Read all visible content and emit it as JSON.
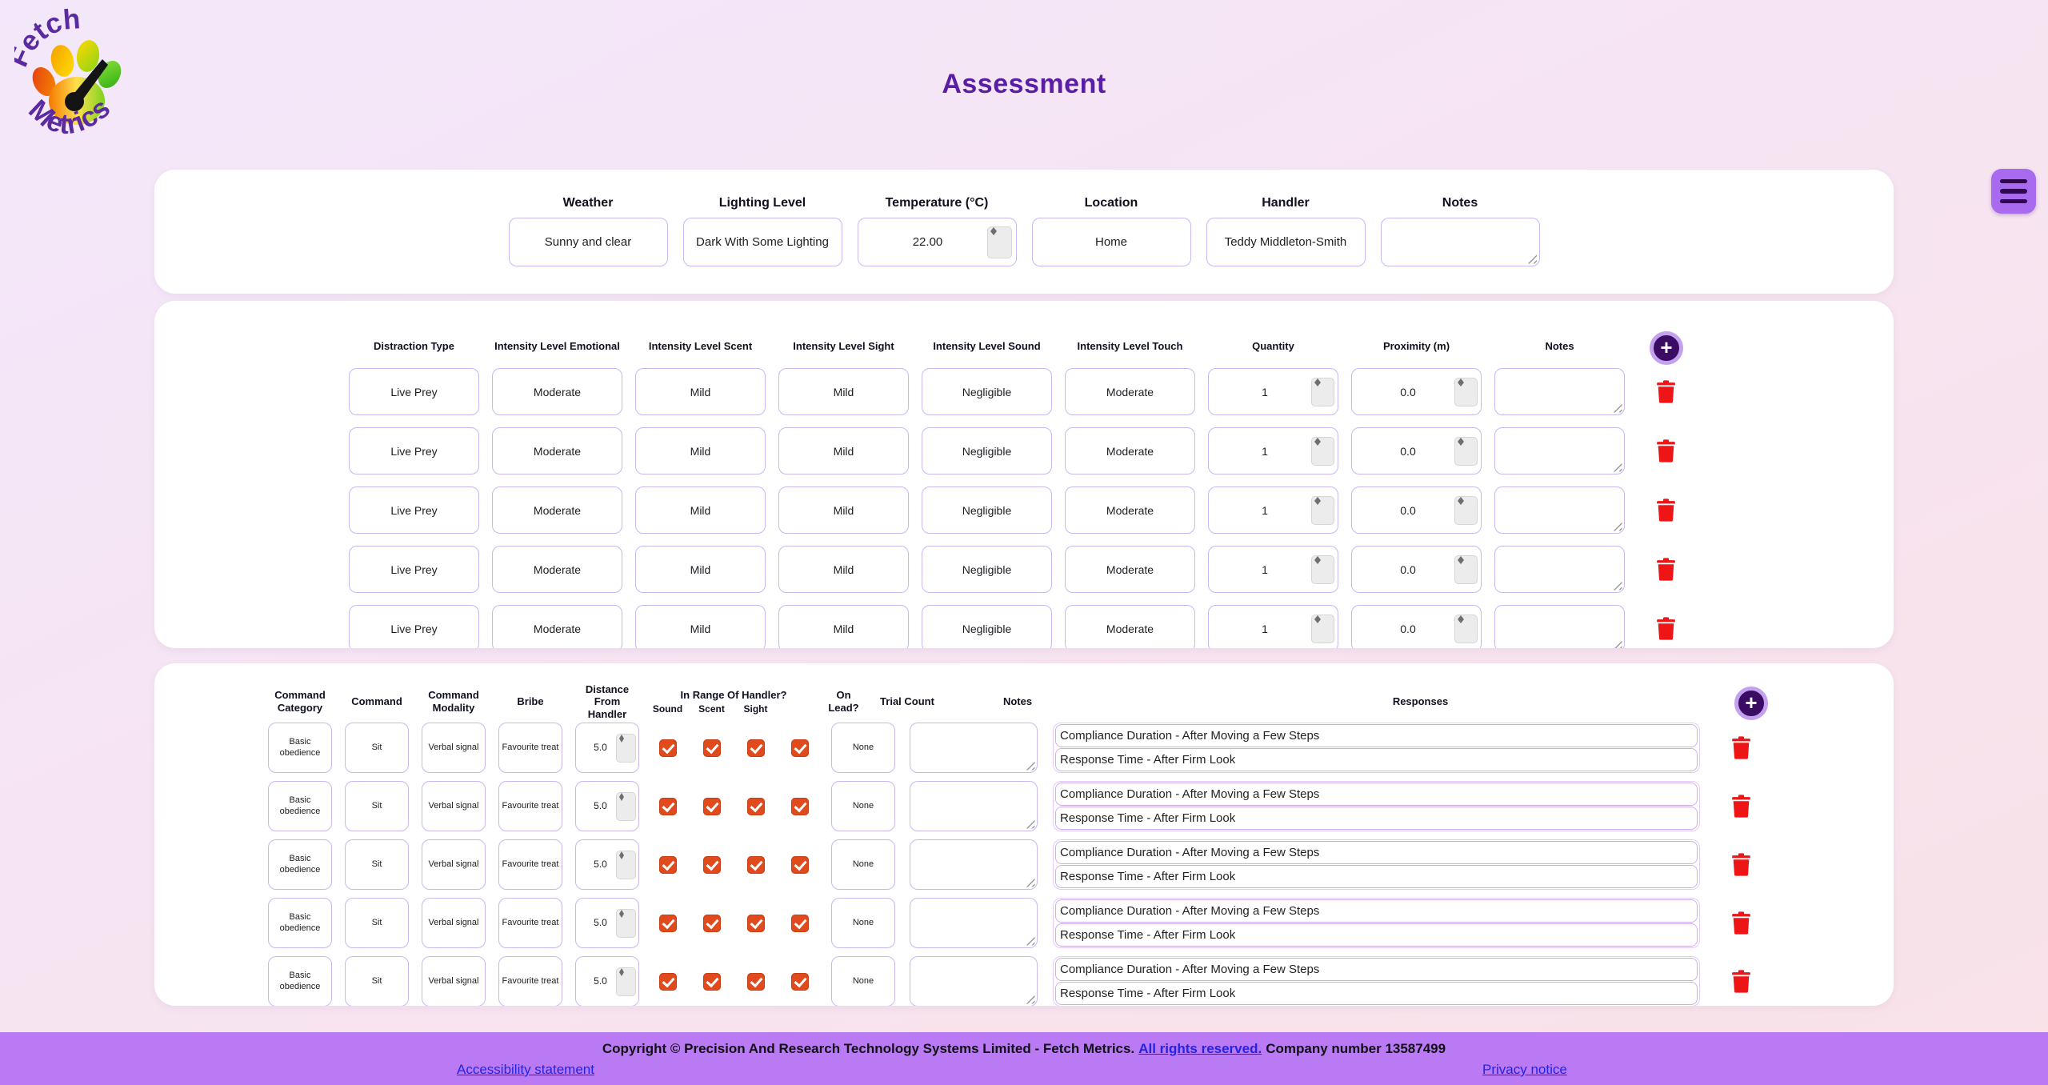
{
  "page_title": "Assessment",
  "logo": {
    "line1": "Fetch",
    "line2": "Metrics"
  },
  "environment": {
    "fields": [
      {
        "label": "Weather",
        "value": "Sunny and clear",
        "type": "text"
      },
      {
        "label": "Lighting Level",
        "value": "Dark With Some Lighting",
        "type": "text"
      },
      {
        "label": "Temperature (°C)",
        "value": "22.00",
        "type": "number"
      },
      {
        "label": "Location",
        "value": "Home",
        "type": "text"
      },
      {
        "label": "Handler",
        "value": "Teddy Middleton-Smith",
        "type": "text"
      },
      {
        "label": "Notes",
        "value": "",
        "type": "textarea"
      }
    ]
  },
  "distractions": {
    "columns": [
      "Distraction Type",
      "Intensity Level Emotional",
      "Intensity Level Scent",
      "Intensity Level Sight",
      "Intensity Level Sound",
      "Intensity Level Touch",
      "Quantity",
      "Proximity (m)",
      "Notes"
    ],
    "add_label": "+",
    "rows": [
      {
        "type": "Live Prey",
        "emotional": "Moderate",
        "scent": "Mild",
        "sight": "Mild",
        "sound": "Negligible",
        "touch": "Moderate",
        "quantity": "1",
        "proximity": "0.0",
        "notes": ""
      },
      {
        "type": "Live Prey",
        "emotional": "Moderate",
        "scent": "Mild",
        "sight": "Mild",
        "sound": "Negligible",
        "touch": "Moderate",
        "quantity": "1",
        "proximity": "0.0",
        "notes": ""
      },
      {
        "type": "Live Prey",
        "emotional": "Moderate",
        "scent": "Mild",
        "sight": "Mild",
        "sound": "Negligible",
        "touch": "Moderate",
        "quantity": "1",
        "proximity": "0.0",
        "notes": ""
      },
      {
        "type": "Live Prey",
        "emotional": "Moderate",
        "scent": "Mild",
        "sight": "Mild",
        "sound": "Negligible",
        "touch": "Moderate",
        "quantity": "1",
        "proximity": "0.0",
        "notes": ""
      },
      {
        "type": "Live Prey",
        "emotional": "Moderate",
        "scent": "Mild",
        "sight": "Mild",
        "sound": "Negligible",
        "touch": "Moderate",
        "quantity": "1",
        "proximity": "0.0",
        "notes": ""
      }
    ]
  },
  "commands": {
    "headers": {
      "category": "Command Category",
      "command": "Command",
      "modality": "Command Modality",
      "bribe": "Bribe",
      "distance": "Distance From Handler",
      "in_range_group": "In Range Of Handler?",
      "in_range_sub": [
        "Sound",
        "Scent",
        "Sight"
      ],
      "on_lead": "On Lead?",
      "trial_count": "Trial Count",
      "notes": "Notes",
      "responses": "Responses"
    },
    "add_label": "+",
    "rows": [
      {
        "category": "Basic obedience",
        "command": "Sit",
        "modality": "Verbal signal",
        "bribe": "Favourite treat",
        "distance": "5.0",
        "in_range_sound": true,
        "in_range_scent": true,
        "in_range_sight": true,
        "on_lead": true,
        "trial_count": "None",
        "notes": "",
        "responses": [
          "Compliance Duration - After Moving a Few Steps",
          "Response Time - After Firm Look"
        ]
      },
      {
        "category": "Basic obedience",
        "command": "Sit",
        "modality": "Verbal signal",
        "bribe": "Favourite treat",
        "distance": "5.0",
        "in_range_sound": true,
        "in_range_scent": true,
        "in_range_sight": true,
        "on_lead": true,
        "trial_count": "None",
        "notes": "",
        "responses": [
          "Compliance Duration - After Moving a Few Steps",
          "Response Time - After Firm Look"
        ]
      },
      {
        "category": "Basic obedience",
        "command": "Sit",
        "modality": "Verbal signal",
        "bribe": "Favourite treat",
        "distance": "5.0",
        "in_range_sound": true,
        "in_range_scent": true,
        "in_range_sight": true,
        "on_lead": true,
        "trial_count": "None",
        "notes": "",
        "responses": [
          "Compliance Duration - After Moving a Few Steps",
          "Response Time - After Firm Look"
        ]
      },
      {
        "category": "Basic obedience",
        "command": "Sit",
        "modality": "Verbal signal",
        "bribe": "Favourite treat",
        "distance": "5.0",
        "in_range_sound": true,
        "in_range_scent": true,
        "in_range_sight": true,
        "on_lead": true,
        "trial_count": "None",
        "notes": "",
        "responses": [
          "Compliance Duration - After Moving a Few Steps",
          "Response Time - After Firm Look"
        ]
      },
      {
        "category": "Basic obedience",
        "command": "Sit",
        "modality": "Verbal signal",
        "bribe": "Favourite treat",
        "distance": "5.0",
        "in_range_sound": true,
        "in_range_scent": true,
        "in_range_sight": true,
        "on_lead": true,
        "trial_count": "None",
        "notes": "",
        "responses": [
          "Compliance Duration - After Moving a Few Steps",
          "Response Time - After Firm Look"
        ]
      }
    ]
  },
  "footer": {
    "copyright_prefix": "Copyright © Precision And Research Technology Systems Limited - Fetch Metrics.",
    "rights_link": "All rights reserved.",
    "company_suffix": "Company number 13587499",
    "accessibility": "Accessibility statement",
    "privacy": "Privacy notice"
  },
  "colors": {
    "title_purple": "#5a1da5",
    "add_button_purple": "#3a0c63",
    "menu_purple": "#a86bf0",
    "checkbox_orange": "#e04a1c",
    "trash_red": "#ed1515",
    "footer_purple": "#b97af3",
    "input_border_purple": "#c9b7f0",
    "link_blue": "#2323e6"
  }
}
